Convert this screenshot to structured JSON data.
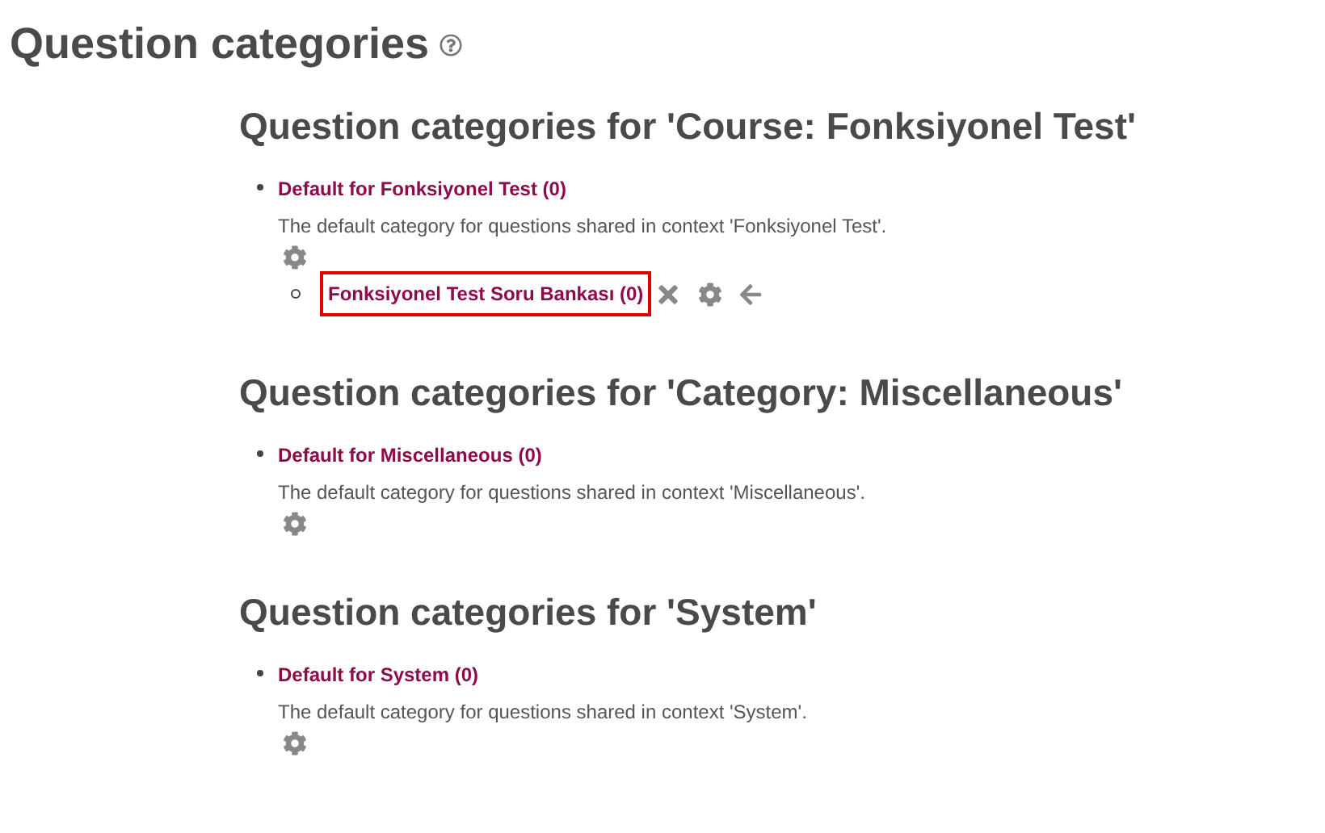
{
  "title": "Question categories",
  "sections": [
    {
      "heading": "Question categories for 'Course: Fonksiyonel Test'",
      "items": [
        {
          "name": "Default for Fonksiyonel Test (0)",
          "description": "The default category for questions shared in context 'Fonksiyonel Test'.",
          "actions": [
            {
              "kind": "settings"
            }
          ],
          "highlighted": false,
          "children": [
            {
              "name": "Fonksiyonel Test Soru Bankası (0)",
              "actions": [
                {
                  "kind": "delete"
                },
                {
                  "kind": "settings"
                },
                {
                  "kind": "move-left"
                }
              ],
              "highlighted": true
            }
          ]
        }
      ]
    },
    {
      "heading": "Question categories for 'Category: Miscellaneous'",
      "items": [
        {
          "name": "Default for Miscellaneous (0)",
          "description": "The default category for questions shared in context 'Miscellaneous'.",
          "actions": [
            {
              "kind": "settings"
            }
          ],
          "highlighted": false
        }
      ]
    },
    {
      "heading": "Question categories for 'System'",
      "items": [
        {
          "name": "Default for System (0)",
          "description": "The default category for questions shared in context 'System'.",
          "actions": [
            {
              "kind": "settings"
            }
          ],
          "highlighted": false
        }
      ]
    }
  ]
}
